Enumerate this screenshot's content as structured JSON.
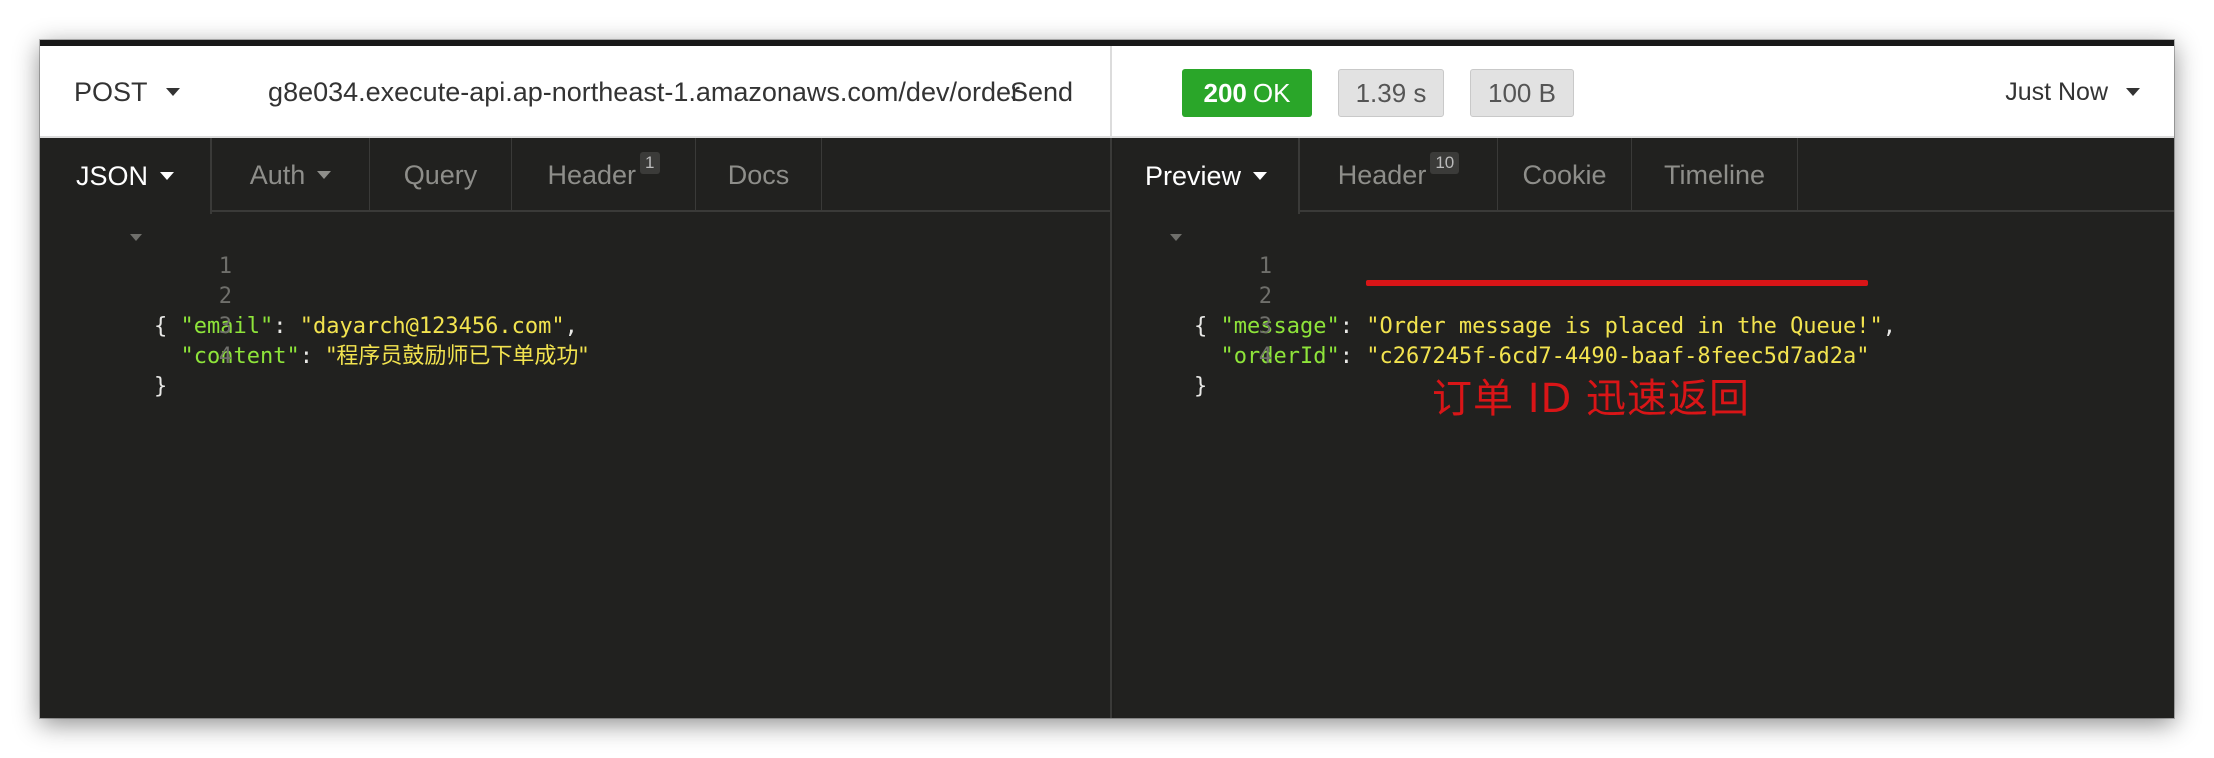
{
  "request": {
    "method": "POST",
    "url": "g8e034.execute-api.ap-northeast-1.amazonaws.com/dev/order",
    "send_label": "Send"
  },
  "response_meta": {
    "status_code": "200",
    "status_text": "OK",
    "time": "1.39 s",
    "size": "100 B",
    "history": "Just Now"
  },
  "request_tabs": {
    "body": "JSON",
    "auth": "Auth",
    "query": "Query",
    "header": "Header",
    "header_count": "1",
    "docs": "Docs"
  },
  "response_tabs": {
    "preview": "Preview",
    "header": "Header",
    "header_count": "10",
    "cookie": "Cookie",
    "timeline": "Timeline"
  },
  "request_body": {
    "line_numbers": [
      "1",
      "2",
      "3",
      "4"
    ],
    "open_brace": "{",
    "close_brace": "}",
    "email_key": "\"email\"",
    "email_value": "\"dayarch@123456.com\"",
    "content_key": "\"content\"",
    "content_value": "\"程序员鼓励师已下单成功\""
  },
  "response_body": {
    "line_numbers": [
      "1",
      "2",
      "3",
      "4"
    ],
    "open_brace": "{",
    "close_brace": "}",
    "message_key": "\"message\"",
    "message_value": "\"Order message is placed in the Queue!\"",
    "orderId_key": "\"orderId\"",
    "orderId_value": "\"c267245f-6cd7-4490-baaf-8feec5d7ad2a\""
  },
  "annotation": {
    "text": "订单 ID  迅速返回",
    "color": "#d91517"
  },
  "colors": {
    "status_ok": "#2aa629",
    "json_key": "#8ee43a",
    "json_string": "#f2e34f",
    "editor_bg": "#21211f"
  }
}
